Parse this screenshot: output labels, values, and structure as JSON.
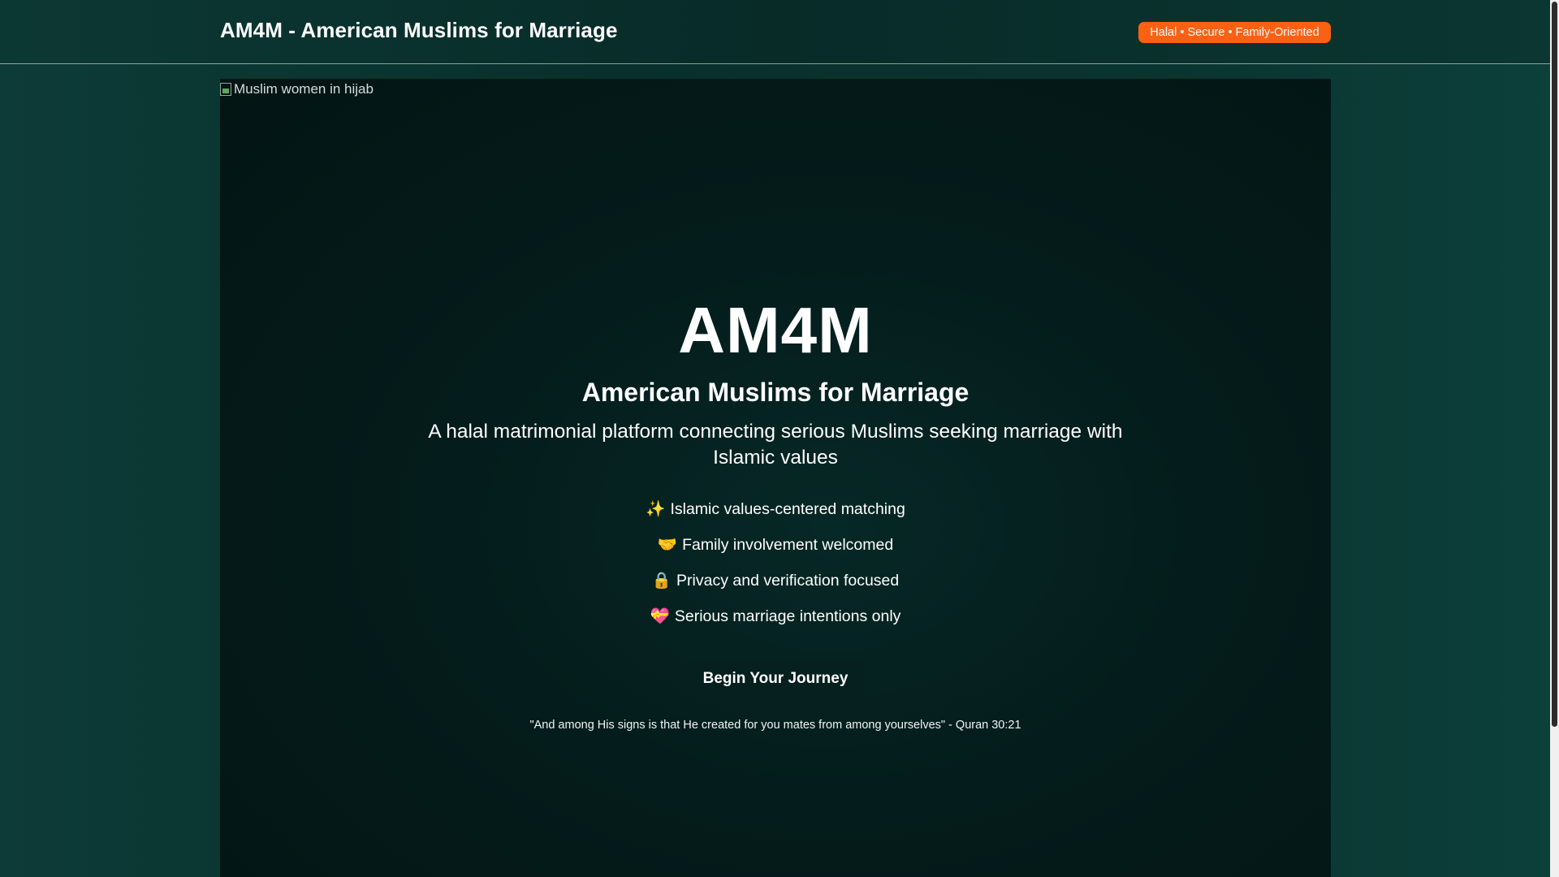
{
  "header": {
    "title": "AM4M - American Muslims for Marriage",
    "badge": "Halal • Secure • Family-Oriented"
  },
  "hero": {
    "image_alt": "Muslim women in hijab",
    "logo": "AM4M",
    "subtitle": "American Muslims for Marriage",
    "description": "A halal matrimonial platform connecting serious Muslims seeking marriage with Islamic values",
    "features": [
      {
        "emoji": "✨",
        "text": "Islamic values-centered matching"
      },
      {
        "emoji": "🤝",
        "text": "Family involvement welcomed"
      },
      {
        "emoji": "🔒",
        "text": "Privacy and verification focused"
      },
      {
        "emoji": "💝",
        "text": "Serious marriage intentions only"
      }
    ],
    "cta_label": "Begin Your Journey",
    "quote": "\"And among His signs is that He created for you mates from among yourselves\" - Quran 30:21"
  },
  "colors": {
    "accent": "#fb6112",
    "background": "#0a3430",
    "hero_background": "#041c1b"
  }
}
